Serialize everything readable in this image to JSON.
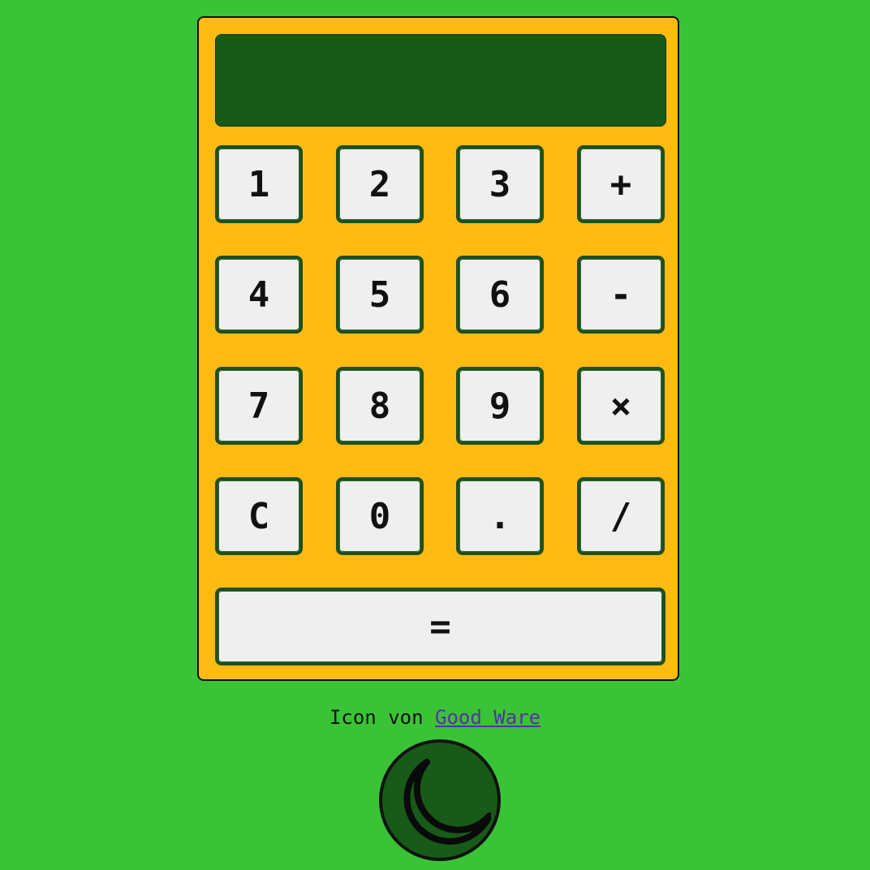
{
  "display": {
    "value": ""
  },
  "keys": {
    "one": "1",
    "two": "2",
    "three": "3",
    "plus": "+",
    "four": "4",
    "five": "5",
    "six": "6",
    "minus": "-",
    "seven": "7",
    "eight": "8",
    "nine": "9",
    "multiply": "×",
    "clear": "C",
    "zero": "0",
    "decimal": ".",
    "divide": "/",
    "equals": "="
  },
  "footer": {
    "credit_prefix": "Icon von",
    "credit_link": "Good Ware"
  },
  "theme_toggle": {
    "icon": "moon-icon"
  },
  "colors": {
    "background": "#3ac336",
    "body": "#ffbb12",
    "display": "#185a18",
    "key": "#efefef",
    "key_border": "#1f4f1f",
    "link": "#5a2fa8"
  }
}
